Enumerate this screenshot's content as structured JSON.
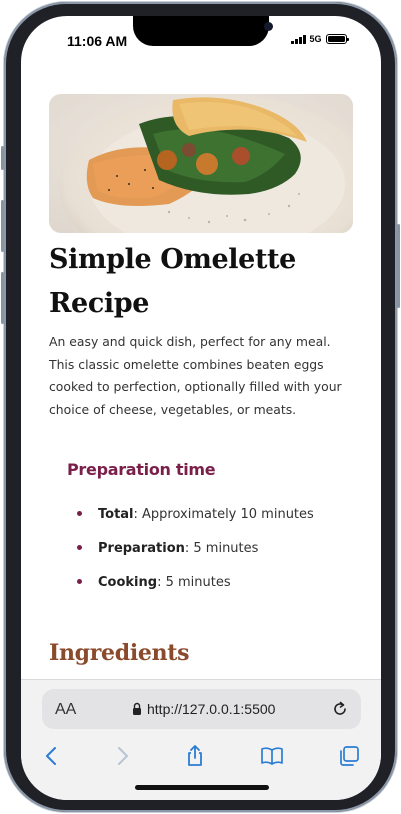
{
  "status_bar": {
    "time": "11:06 AM",
    "network": "5G"
  },
  "page": {
    "title": "Simple Omelette Recipe",
    "intro": "An easy and quick dish, perfect for any meal. This classic omelette combines beaten eggs cooked to perfection, optionally filled with your choice of cheese, vegetables, or meats.",
    "preparation": {
      "heading": "Preparation time",
      "items": [
        {
          "label": "Total",
          "value": ": Approximately 10 minutes"
        },
        {
          "label": "Preparation",
          "value": ": 5 minutes"
        },
        {
          "label": "Cooking",
          "value": ": 5 minutes"
        }
      ]
    },
    "ingredients_heading": "Ingredients"
  },
  "browser": {
    "aa_label": "AA",
    "url": "http://127.0.0.1:5500"
  },
  "colors": {
    "heading_purple": "#7a1f4a",
    "ingredients_brown": "#8a4a2c",
    "toolbar_blue": "#2b7cd3"
  }
}
